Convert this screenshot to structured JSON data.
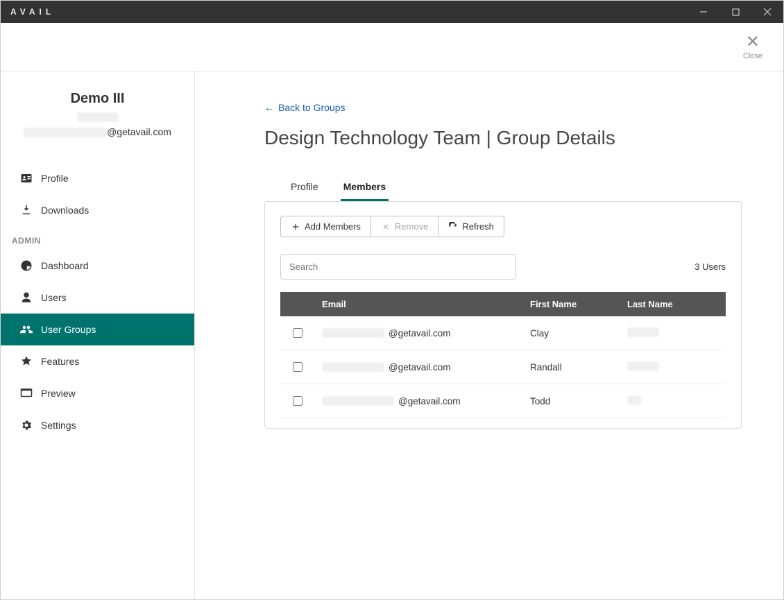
{
  "app_title": "AVAIL",
  "close_label": "Close",
  "sidebar": {
    "user_name": "Demo III",
    "user_email_domain": "@getavail.com",
    "items_top": [
      {
        "label": "Profile"
      },
      {
        "label": "Downloads"
      }
    ],
    "admin_heading": "ADMIN",
    "items_admin": [
      {
        "label": "Dashboard"
      },
      {
        "label": "Users"
      },
      {
        "label": "User Groups",
        "active": true
      },
      {
        "label": "Features"
      },
      {
        "label": "Preview"
      },
      {
        "label": "Settings"
      }
    ]
  },
  "main": {
    "back_link": "Back to Groups",
    "page_title": "Design Technology Team | Group Details",
    "tabs": {
      "profile": "Profile",
      "members": "Members"
    },
    "buttons": {
      "add": "Add Members",
      "remove": "Remove",
      "refresh": "Refresh"
    },
    "search_placeholder": "Search",
    "user_count": "3 Users",
    "columns": {
      "email": "Email",
      "first": "First Name",
      "last": "Last Name"
    },
    "rows": [
      {
        "email_domain": "@getavail.com",
        "first": "Clay"
      },
      {
        "email_domain": "@getavail.com",
        "first": "Randall"
      },
      {
        "email_domain": "@getavail.com",
        "first": "Todd"
      }
    ]
  }
}
